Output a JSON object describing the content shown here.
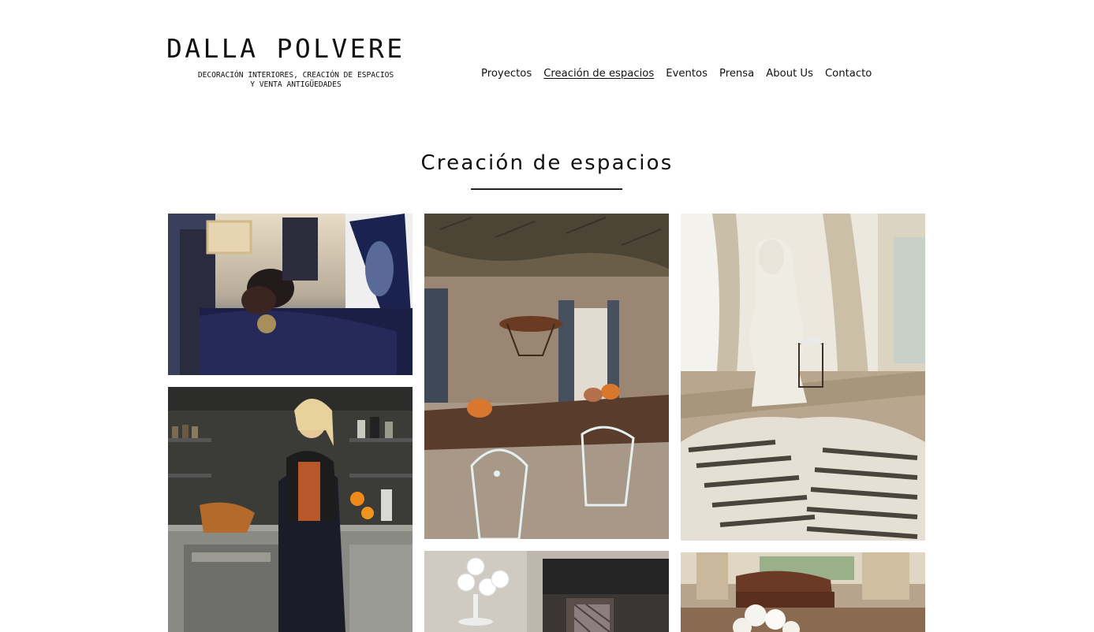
{
  "site": {
    "logo_name": "DALLA POLVERE",
    "logo_tagline_1": "DECORACIÓN INTERIORES, CREACIÓN DE ESPACIOS",
    "logo_tagline_2": "Y VENTA ANTIGÜEDADES"
  },
  "nav": {
    "items": [
      {
        "label": "Proyectos",
        "active": false
      },
      {
        "label": "Creación de espacios",
        "active": true
      },
      {
        "label": "Eventos",
        "active": false
      },
      {
        "label": "Prensa",
        "active": false
      },
      {
        "label": "About Us",
        "active": false
      },
      {
        "label": "Contacto",
        "active": false
      }
    ]
  },
  "main": {
    "title": "Creación de espacios"
  },
  "colors": {
    "text": "#111111",
    "background": "#ffffff"
  }
}
